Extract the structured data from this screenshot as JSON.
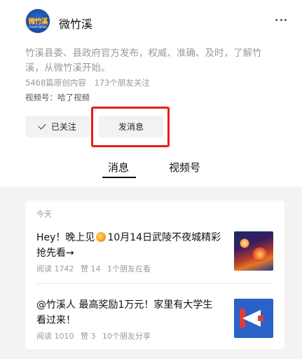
{
  "account": {
    "avatar_text": "微竹溪",
    "avatar_sub": "CHUXI NEWS",
    "name": "微竹溪"
  },
  "profile": {
    "description": "竹溪县委、县政府官方发布，权威、准确、及时，了解竹溪，从微竹溪开始。",
    "original_count": "5468篇原创内容",
    "friends_following": "173个朋友关注",
    "channel": "视频号：哈了视频"
  },
  "actions": {
    "followed_label": "已关注",
    "message_label": "发消息"
  },
  "tabs": [
    {
      "label": "消息"
    },
    {
      "label": "视频号"
    }
  ],
  "feed": {
    "date_label": "今天",
    "articles": [
      {
        "title_before": "Hey！晚上见",
        "title_after": "10月14日武陵不夜城精彩抢先看→",
        "reads": "阅读 1742",
        "likes": "赞 14",
        "friends": "1个朋友在看",
        "thumb_icon": "night-festival-thumbnail"
      },
      {
        "title": "@竹溪人 最高奖励1万元！家里有大学生看过来！",
        "reads": "阅读 1010",
        "likes": "赞 3",
        "friends": "10个朋友分享",
        "thumb_icon": "megaphone-thumbnail"
      }
    ]
  },
  "colors": {
    "highlight": "#e3201b",
    "muted_text": "#9a9a9a",
    "button_bg": "#f2f2f2",
    "feed_bg": "#f3f3f3"
  }
}
